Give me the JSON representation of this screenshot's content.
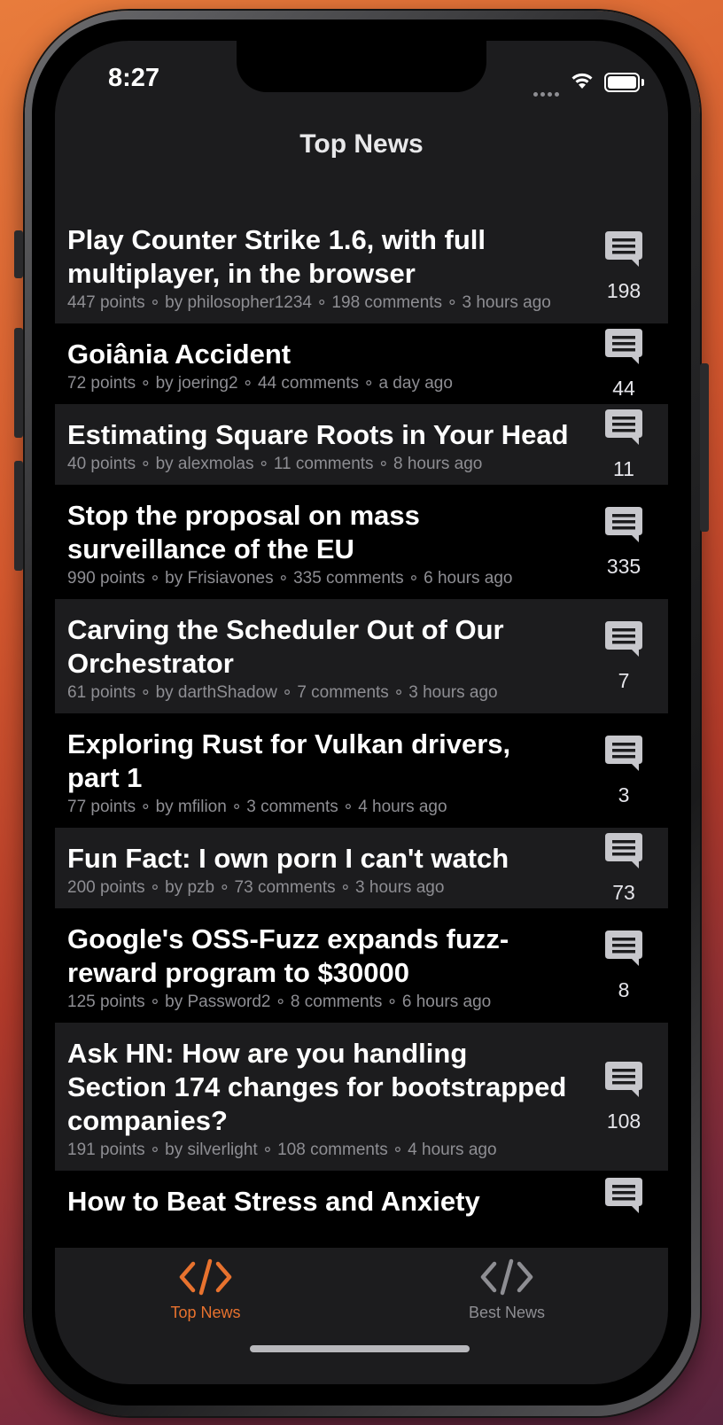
{
  "status_bar": {
    "time": "8:27"
  },
  "nav": {
    "title": "Top News"
  },
  "stories": [
    {
      "title": "Play Counter Strike 1.6, with full multiplayer, in the browser",
      "meta": "447 points ∘ by philosopher1234 ∘ 198 comments ∘ 3 hours ago",
      "comments": "198"
    },
    {
      "title": "Goiânia Accident",
      "meta": "72 points ∘ by joering2 ∘ 44 comments ∘ a day ago",
      "comments": "44"
    },
    {
      "title": "Estimating Square Roots in Your Head",
      "meta": "40 points ∘ by alexmolas ∘ 11 comments ∘ 8 hours ago",
      "comments": "11"
    },
    {
      "title": "Stop the proposal on mass surveillance of the EU",
      "meta": "990 points ∘ by Frisiavones ∘ 335 comments ∘ 6 hours ago",
      "comments": "335"
    },
    {
      "title": "Carving the Scheduler Out of Our Orchestrator",
      "meta": "61 points ∘ by darthShadow ∘ 7 comments ∘ 3 hours ago",
      "comments": "7"
    },
    {
      "title": "Exploring Rust for Vulkan drivers, part 1",
      "meta": "77 points ∘ by mfilion ∘ 3 comments ∘ 4 hours ago",
      "comments": "3"
    },
    {
      "title": "Fun Fact: I own porn I can't watch",
      "meta": "200 points ∘ by pzb ∘ 73 comments ∘ 3 hours ago",
      "comments": "73"
    },
    {
      "title": "Google's OSS-Fuzz expands fuzz-reward program to $30000",
      "meta": "125 points ∘ by Password2 ∘ 8 comments ∘ 6 hours ago",
      "comments": "8"
    },
    {
      "title": "Ask HN: How are you handling Section 174 changes for bootstrapped companies?",
      "meta": "191 points ∘ by silverlight ∘ 108 comments ∘ 4 hours ago",
      "comments": "108"
    },
    {
      "title": "How to Beat Stress and Anxiety",
      "meta": "",
      "comments": ""
    }
  ],
  "tabs": [
    {
      "label": "Top News",
      "icon": "code-icon",
      "active": true
    },
    {
      "label": "Best News",
      "icon": "code-icon",
      "active": false
    }
  ],
  "colors": {
    "accent": "#e8722e",
    "inactive": "#8e8e93",
    "row_alt": "#1c1c1e"
  }
}
